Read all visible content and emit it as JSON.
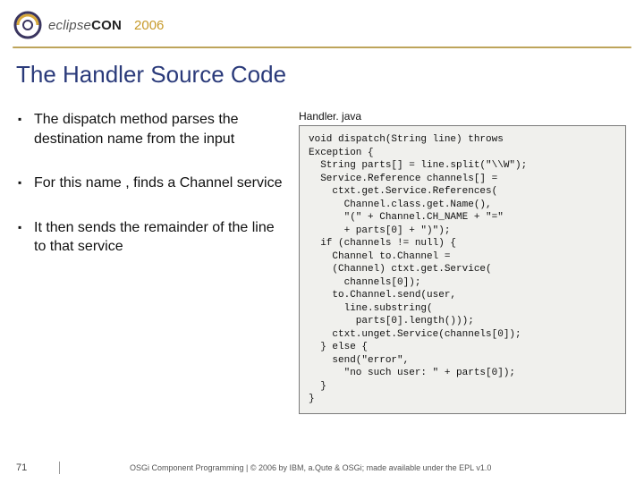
{
  "header": {
    "logo_eclipse": "eclipse",
    "logo_con": "CON",
    "year": "2006"
  },
  "title": "The Handler Source Code",
  "bullets": {
    "b1": "The dispatch method  parses the destination name from the input",
    "b2": "For this name , finds a Channel service",
    "b3": "It then sends the remainder of the line to that service"
  },
  "code": {
    "label": "Handler. java",
    "text": "void dispatch(String line) throws\nException {\n  String parts[] = line.split(\"\\\\W\");\n  Service.Reference channels[] =\n    ctxt.get.Service.References(\n      Channel.class.get.Name(),\n      \"(\" + Channel.CH_NAME + \"=\"\n      + parts[0] + \")\");\n  if (channels != null) {\n    Channel to.Channel =\n    (Channel) ctxt.get.Service(\n      channels[0]);\n    to.Channel.send(user,\n      line.substring(\n        parts[0].length()));\n    ctxt.unget.Service(channels[0]);\n  } else {\n    send(\"error\",\n      \"no such user: \" + parts[0]);\n  }\n}"
  },
  "footer": {
    "page": "71",
    "text": "OSGi Component Programming | © 2006 by IBM, a.Qute & OSGi; made available under the EPL v1.0"
  }
}
